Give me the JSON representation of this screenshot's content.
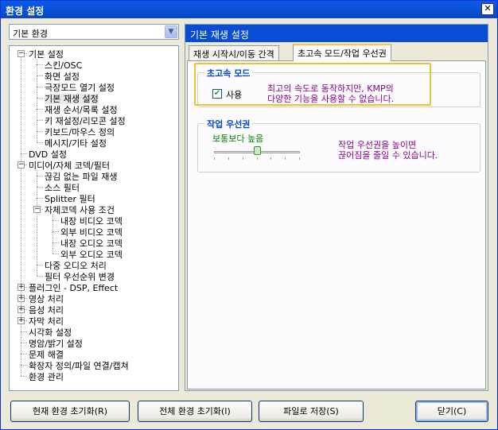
{
  "window": {
    "title": "환경 설정",
    "close": "✕"
  },
  "category_select": {
    "value": "기본 환경",
    "arrow": "▼"
  },
  "tree": {
    "items": [
      {
        "label": "기본 설정",
        "exp": "−"
      },
      {
        "label": "스킨/OSC"
      },
      {
        "label": "화면 설정"
      },
      {
        "label": "극장모드 열기  설정"
      },
      {
        "label": "기본 재생 설정"
      },
      {
        "label": "재생 순서/목록 설정"
      },
      {
        "label": "키 재설정/리모콘 설정"
      },
      {
        "label": "키보드/마우스 정의"
      },
      {
        "label": "메시지/기타 설정"
      },
      {
        "label": "DVD 설정"
      },
      {
        "label": "미디어/자체 코덱/필터",
        "exp": "−"
      },
      {
        "label": "끊김 없는 파일 재생"
      },
      {
        "label": "소스 필터"
      },
      {
        "label": "Splitter 필터"
      },
      {
        "label": "자체코덱 사용 조건",
        "exp": "−"
      },
      {
        "label": "내장 비디오 코덱"
      },
      {
        "label": "외부 비디오 코덱"
      },
      {
        "label": "내장 오디오 코덱"
      },
      {
        "label": "외부 오디오 코덱"
      },
      {
        "label": "다중 오디오 처리"
      },
      {
        "label": "필터 우선순위 변경"
      },
      {
        "label": "플러그인 - DSP, Effect",
        "exp": "+"
      },
      {
        "label": "영상 처리",
        "exp": "+"
      },
      {
        "label": "음성 처리",
        "exp": "+"
      },
      {
        "label": "자막 처리",
        "exp": "+"
      },
      {
        "label": "시각화 설정"
      },
      {
        "label": "명암/밝기 설정"
      },
      {
        "label": "문제 해결"
      },
      {
        "label": "확장자 정의/파일 연결/캡쳐"
      },
      {
        "label": "환경 관리"
      }
    ]
  },
  "panel": {
    "header": "기본 재생 설정",
    "tabs": [
      {
        "label": "재생 시작시/이동 간격"
      },
      {
        "label": "초고속 모드/작업 우선권"
      }
    ],
    "turbo": {
      "title": "초고속 모드",
      "checkbox_label": "사용",
      "check_mark": "✔",
      "desc_line1": "최고의 속도로 동작하지만,  KMP의",
      "desc_line2": "다양한 기능을 사용할 수 없습니다."
    },
    "priority": {
      "title": "작업 우선권",
      "current": "보통보다 높음",
      "desc_line1": "작업 우선권을 높이면",
      "desc_line2": "끊어짐을 줄일 수 있습니다.",
      "slider_level": 3,
      "slider_max": 6
    }
  },
  "buttons": {
    "reset_current": "현재 환경 초기화(R)",
    "reset_all": "전체 환경 초기화(I)",
    "save_file": "파일로 저장(S)",
    "close": "닫기(C)"
  }
}
